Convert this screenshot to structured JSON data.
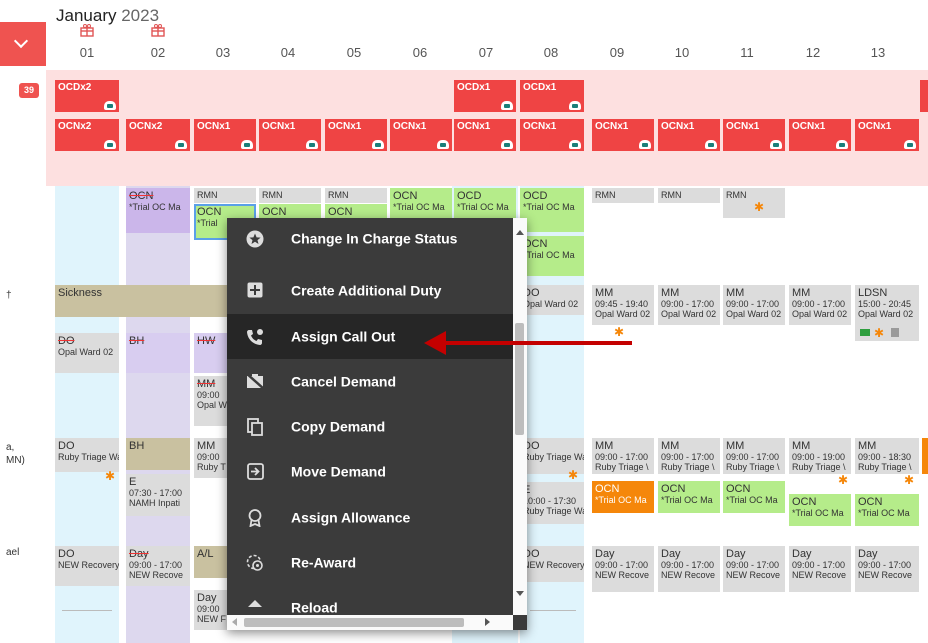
{
  "header": {
    "month": "January",
    "year": "2023",
    "badge": "39"
  },
  "days": [
    "01",
    "02",
    "03",
    "04",
    "05",
    "06",
    "07",
    "08",
    "09",
    "10",
    "11",
    "12",
    "13"
  ],
  "left_labels": {
    "a": "†",
    "b": "a,",
    "c": "MN)",
    "d": "ael"
  },
  "oncall_row1": {
    "d01": "OCDx2",
    "d07": "OCDx1",
    "d08": "OCDx1"
  },
  "oncall_row2": {
    "d01": "OCNx2",
    "d02": "OCNx2",
    "other": "OCNx1"
  },
  "shifts": {
    "ocn": "OCN",
    "ocd": "OCD",
    "rmn": "RMN",
    "trial": "*Trial OC Ma",
    "trial_short": "*Trial",
    "sickness": "Sickness",
    "do": "DO",
    "bh": "BH",
    "hw": "HW",
    "mm": "MM",
    "ldsn": "LDSN",
    "e": "E",
    "day": "Day",
    "al": "A/L",
    "opal": "Opal Ward 02",
    "opal_short": "Opal Ward 0",
    "opal_w": "Opal W",
    "ruby": "Ruby Triage Wa",
    "ruby_short": "Ruby Triage \\",
    "ruby_t": "Ruby T",
    "new_recovery": "NEW Recovery",
    "new_recove": "NEW Recove",
    "new_f": "NEW F",
    "namh": "NAMH Inpati",
    "t0945": "09:45 - 19:40",
    "t0900_1700": "09:00 - 17:00",
    "t0900_1900": "09:00 - 19:00",
    "t0900_1830": "09:00 - 18:30",
    "t1500": "15:00 - 20:45",
    "t0730": "07:30 - 17:00",
    "t1000": "10:00 - 17:30",
    "t0900": "09:00",
    "opal_ward_e": "Opal Ward 0£"
  },
  "context_menu": {
    "items": [
      {
        "label": "Change In Charge Status",
        "icon": "star-circle-icon"
      },
      {
        "label": "Create Additional Duty",
        "icon": "plus-box-icon"
      },
      {
        "label": "Assign Call Out",
        "icon": "phone-callout-icon"
      },
      {
        "label": "Cancel Demand",
        "icon": "cancel-demand-icon"
      },
      {
        "label": "Copy Demand",
        "icon": "copy-icon"
      },
      {
        "label": "Move Demand",
        "icon": "move-icon"
      },
      {
        "label": "Assign Allowance",
        "icon": "award-icon"
      },
      {
        "label": "Re-Award",
        "icon": "re-award-icon"
      },
      {
        "label": "Reload",
        "icon": "reload-icon"
      }
    ],
    "highlighted": "Assign Call Out"
  },
  "colors": {
    "accent": "#ef5350",
    "oncall": "#ef4444",
    "pink_band": "#fde0e0",
    "green": "#b5ec8a",
    "orange": "#f5870a",
    "annotation_arrow": "#c40000",
    "menu_bg": "#3b3b3b"
  }
}
